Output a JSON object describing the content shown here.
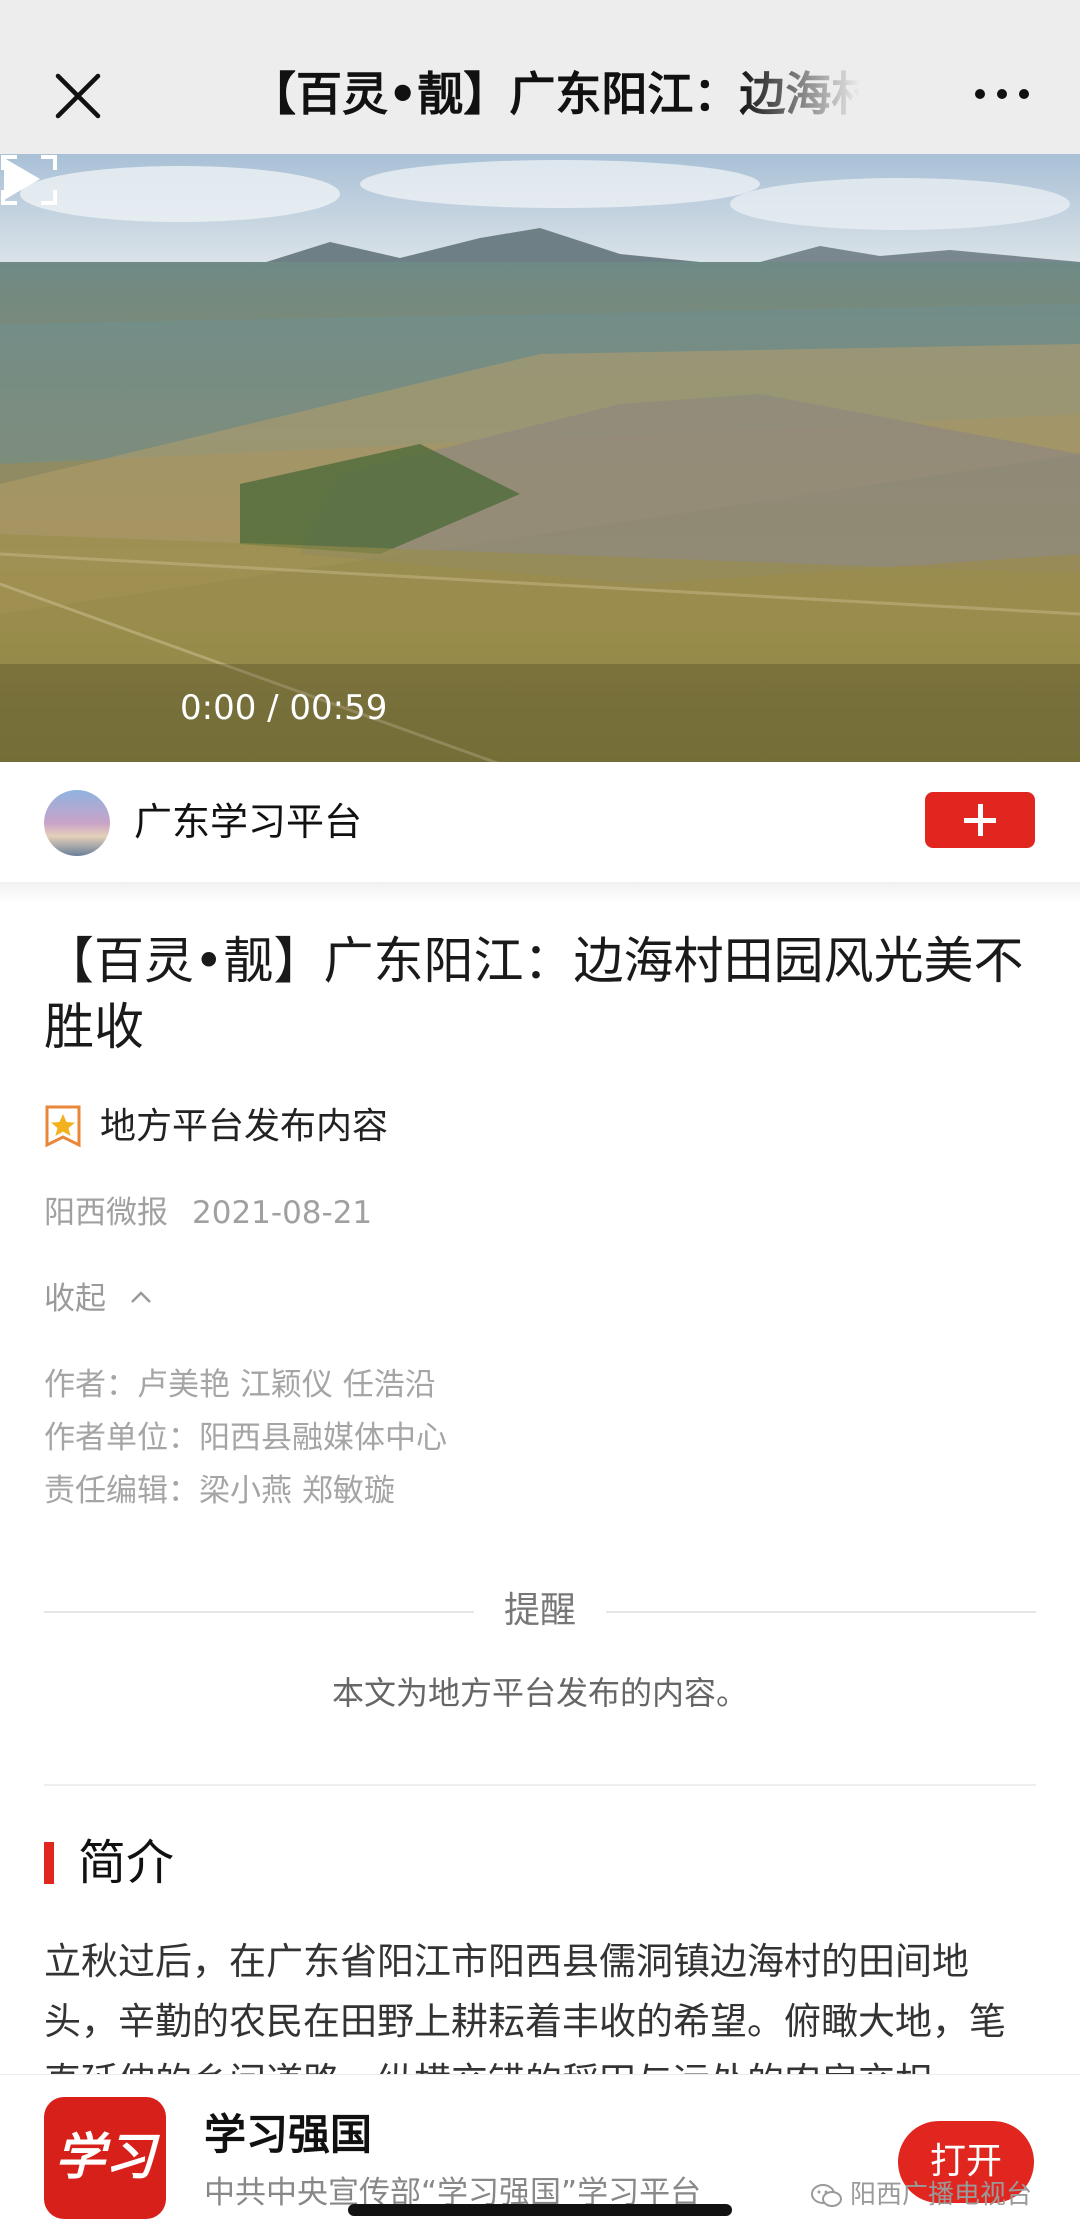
{
  "topbar": {
    "title": "【百灵•靓】广东阳江：边海村田园风光美不胜收"
  },
  "video": {
    "time": "0:00 / 00:59"
  },
  "source": {
    "name": "广东学习平台"
  },
  "article": {
    "title": "【百灵•靓】广东阳江：边海村田园风光美不胜收",
    "badge": "地方平台发布内容",
    "publisher": "阳西微报",
    "date": "2021-08-21",
    "collapse_label": "收起",
    "authors": "作者：卢美艳 江颖仪 任浩沿",
    "unit": "作者单位：阳西县融媒体中心",
    "editors": "责任编辑：梁小燕 郑敏璇",
    "reminder_title": "提醒",
    "reminder_text": "本文为地方平台发布的内容。",
    "intro_heading": "简介",
    "intro_body": "立秋过后，在广东省阳江市阳西县儒洞镇边海村的田间地头，辛勤的农民在田野上耕耘着丰收的希望。俯瞰大地，笔直延伸的乡间道路，纵横交错的稻田与远处的农房交相"
  },
  "banner": {
    "logo_text": "学习",
    "app_name": "学习强国",
    "app_sub": "中共中央宣传部“学习强国”学习平台",
    "open_label": "打开",
    "watermark": "阳西广播电视台"
  },
  "colors": {
    "accent": "#e0261e",
    "topbar_bg": "#ededed",
    "meta_gray": "#a0a0a0"
  },
  "icons": [
    "close-icon",
    "more-icon",
    "play-icon",
    "fullscreen-icon",
    "plus-icon",
    "star-badge-icon",
    "chevron-up-icon",
    "wechat-icon"
  ]
}
